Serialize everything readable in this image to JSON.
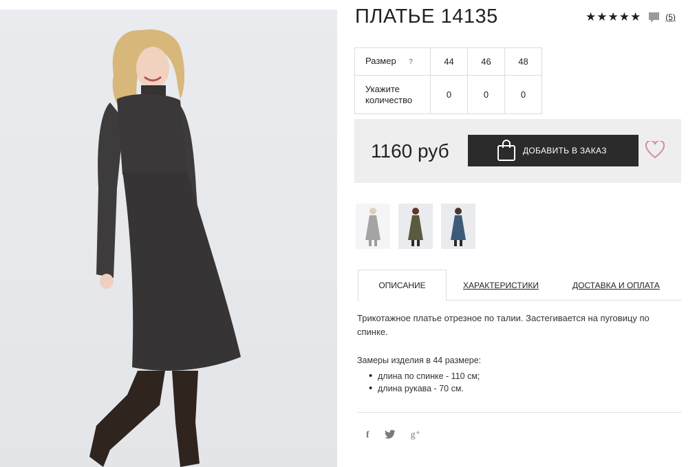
{
  "product": {
    "title": "ПЛАТЬЕ 14135",
    "stars": "★★★★★",
    "review_count": "(5)"
  },
  "sizes": {
    "header_label": "Размер",
    "help": "?",
    "values": [
      "44",
      "46",
      "48"
    ],
    "quantity_label": "Укажите количество",
    "quantities": [
      "0",
      "0",
      "0"
    ]
  },
  "purchase": {
    "price": "1160 руб",
    "add_button": "ДОБАВИТЬ В ЗАКАЗ"
  },
  "tabs": [
    "ОПИСАНИЕ",
    "ХАРАКТЕРИСТИКИ",
    "ДОСТАВКА И ОПЛАТА"
  ],
  "description": {
    "text": "Трикотажное платье отрезное по талии. Застегивается на пуговицу по спинке.",
    "measure_title": "Замеры изделия в 44 размере:",
    "measures": [
      "длина по спинке - 110 см;",
      "длина рукава - 70 см."
    ]
  },
  "social": {
    "facebook": "f",
    "twitter": "🐦",
    "google": "g⁺"
  },
  "colors": {
    "dress": "#3a3838",
    "thumb_olive": "#5b5a3e",
    "thumb_blue": "#3e5a7a",
    "heart": "#d9889a"
  },
  "icons": [
    "comment-icon",
    "shopping-bag-icon",
    "heart-icon",
    "facebook-icon",
    "twitter-icon",
    "google-plus-icon"
  ]
}
